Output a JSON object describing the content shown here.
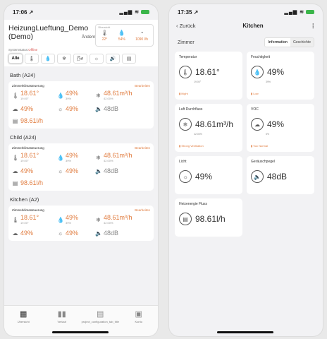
{
  "left": {
    "status": {
      "time": "17:06 ↗",
      "signal": "▂▄▆ ≋"
    },
    "header": {
      "title": "HeizungLueftung_Demo (Demo)",
      "edit": "Ändern"
    },
    "summary": {
      "label": "Übersicht",
      "temp": "22°",
      "humidity": "54%",
      "flow": "1090 l/h"
    },
    "system_status": {
      "label": "Systemstatus:",
      "value": "Offline"
    },
    "filters": [
      "Alle",
      "🌡",
      "💧",
      "❄",
      "🌬",
      "☼",
      "🔊",
      "▤"
    ],
    "rooms": [
      {
        "name": "Bath (A24)",
        "heading": "Zimmerklimasteuerung",
        "edit": "Bearbeiten",
        "temp": "18.61°",
        "temp_sub": "19.00°",
        "humidity": "49%",
        "humidity_sub": "39%",
        "flow": "48.61m³/h",
        "flow_sub": "42.00%",
        "voc": "49%",
        "light": "49%",
        "noise": "48dB",
        "energy": "98.61l/h"
      },
      {
        "name": "Child (A24)",
        "heading": "Zimmerklimasteuerung",
        "edit": "Bearbeiten",
        "temp": "18.61°",
        "temp_sub": "19.00°",
        "humidity": "49%",
        "humidity_sub": "39%",
        "flow": "48.61m³/h",
        "flow_sub": "42.00%",
        "voc": "49%",
        "light": "49%",
        "noise": "48dB",
        "energy": "98.61l/h"
      },
      {
        "name": "Kitchen (A2)",
        "heading": "Zimmerklimasteuerung",
        "edit": "Bearbeiten",
        "temp": "18.61°",
        "temp_sub": "19.00°",
        "humidity": "49%",
        "humidity_sub": "39%",
        "flow": "48.61m³/h",
        "flow_sub": "42.00%",
        "voc": "49%",
        "light": "49%",
        "noise": "48dB"
      }
    ],
    "tabs": [
      {
        "label": "Übersicht",
        "icon": "▦"
      },
      {
        "label": "Verlauf",
        "icon": "▮▮"
      },
      {
        "label": "project_configuration_tab_title",
        "icon": "▤"
      },
      {
        "label": "Konto",
        "icon": "▣"
      }
    ]
  },
  "right": {
    "status": {
      "time": "17:35 ↗",
      "signal": "▂▄▆ ≋"
    },
    "nav": {
      "back": "‹ Zurück",
      "title": "Kitchen",
      "more": "⋮"
    },
    "section": "Zimmer",
    "segments": [
      "Information",
      "Geschichte"
    ],
    "tiles": {
      "temp": {
        "label": "Temperatur",
        "value": "18.61°",
        "sub": "19.00°",
        "status": "▮ Night"
      },
      "humidity": {
        "label": "Feuchtigkeit",
        "value": "49%",
        "sub": "39%",
        "status": "▮ Low"
      },
      "flow": {
        "label": "Luft Durchfluss",
        "value": "48.61m³/h",
        "sub": "42.00%",
        "status": "▮ Strong Ventilation"
      },
      "voc": {
        "label": "VOC",
        "value": "49%",
        "sub": "5%",
        "status": "▮ Voc Normal"
      },
      "light": {
        "label": "Licht",
        "value": "49%"
      },
      "noise": {
        "label": "Geräuschpegel",
        "value": "48dB"
      },
      "energy": {
        "label": "Heizenergie Fluss",
        "value": "98.61l/h"
      }
    }
  },
  "colors": {
    "accent": "#e07a3c",
    "background": "#f2f2f4"
  }
}
